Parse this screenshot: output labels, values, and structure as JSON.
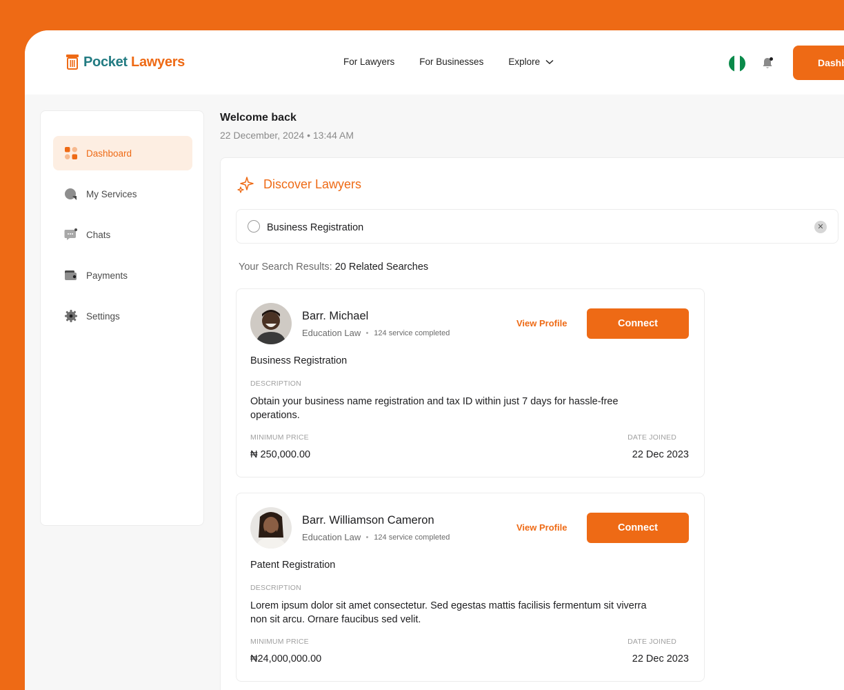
{
  "brand": {
    "name_part1": "Pocket",
    "name_part2": " Lawyers",
    "colors": {
      "primary": "#EE6A15",
      "teal": "#227B82"
    }
  },
  "nav": {
    "items": [
      "For Lawyers",
      "For Businesses",
      "Explore"
    ]
  },
  "header": {
    "flag_icon": "nigeria-flag-icon",
    "bell_icon": "bell-icon",
    "dashboard_button": "Dashboard"
  },
  "sidebar": {
    "items": [
      {
        "label": "Dashboard",
        "icon": "grid-icon",
        "active": true
      },
      {
        "label": "My Services",
        "icon": "pie-chart-icon"
      },
      {
        "label": "Chats",
        "icon": "chat-icon"
      },
      {
        "label": "Payments",
        "icon": "wallet-icon"
      },
      {
        "label": "Settings",
        "icon": "gear-icon"
      }
    ]
  },
  "main": {
    "welcome": "Welcome back",
    "datetime": "22 December, 2024 • 13:44 AM",
    "discover_title": "Discover Lawyers",
    "search": {
      "value": "Business Registration"
    },
    "results_prefix": "Your Search Results: ",
    "results_count": "20 Related Searches",
    "labels": {
      "description": "DESCRIPTION",
      "min_price": "MINIMUM PRICE",
      "date_joined": "DATE JOINED",
      "view_profile": "View Profile",
      "connect": "Connect"
    },
    "cards": [
      {
        "name": "Barr. Michael",
        "practice": "Education Law",
        "completed": "124 service completed",
        "service": "Business Registration",
        "description": "Obtain your business name registration and tax ID within just 7 days for hassle-free operations.",
        "price": "₦ 250,000.00",
        "joined": "22 Dec 2023"
      },
      {
        "name": "Barr. Williamson Cameron",
        "practice": "Education Law",
        "completed": "124 service completed",
        "service": "Patent Registration",
        "description": "Lorem ipsum dolor sit amet consectetur. Sed egestas mattis facilisis fermentum sit viverra non sit arcu. Ornare faucibus sed velit.",
        "price": "₦24,000,000.00",
        "joined": "22 Dec 2023"
      }
    ]
  }
}
